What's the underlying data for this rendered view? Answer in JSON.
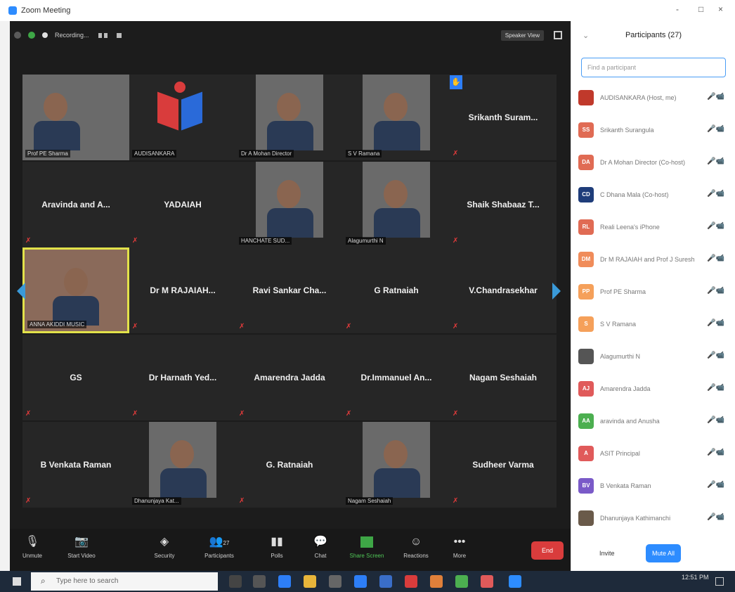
{
  "window": {
    "title": "Zoom Meeting",
    "minimize": "-",
    "restore": "□",
    "close": "×"
  },
  "meeting": {
    "recording_label": "Recording...",
    "speaker_view_label": "Speaker View"
  },
  "tiles": [
    {
      "text": "Prof PE Sharma",
      "kind": "video"
    },
    {
      "text": "AUDISANKARA",
      "kind": "logo"
    },
    {
      "text": "Dr A Mohan Director",
      "kind": "video"
    },
    {
      "text": "S V Ramana",
      "kind": "video"
    },
    {
      "text": "Srikanth Suram...",
      "kind": "name"
    },
    {
      "text": "Aravinda and A...",
      "kind": "name"
    },
    {
      "text": "YADAIAH",
      "kind": "name"
    },
    {
      "text": "HANCHATE SUD...",
      "kind": "video"
    },
    {
      "text": "Alagumurthi N",
      "kind": "video"
    },
    {
      "text": "Shaik Shabaaz T...",
      "kind": "name"
    },
    {
      "text": "ANNA AKIDDI MUSIC",
      "kind": "active"
    },
    {
      "text": "Dr M RAJAIAH...",
      "kind": "name"
    },
    {
      "text": "Ravi Sankar Cha...",
      "kind": "name"
    },
    {
      "text": "G Ratnaiah",
      "kind": "name"
    },
    {
      "text": "V.Chandrasekhar",
      "kind": "name"
    },
    {
      "text": "GS",
      "kind": "name"
    },
    {
      "text": "Dr Harnath Yed...",
      "kind": "name"
    },
    {
      "text": "Amarendra Jadda",
      "kind": "name"
    },
    {
      "text": "Dr.Immanuel An...",
      "kind": "name"
    },
    {
      "text": "Nagam Seshaiah",
      "kind": "name"
    },
    {
      "text": "B Venkata Raman",
      "kind": "name"
    },
    {
      "text": "Dhanunjaya Kat...",
      "kind": "video"
    },
    {
      "text": "G. Ratnaiah",
      "kind": "name"
    },
    {
      "text": "Nagam Seshaiah",
      "kind": "video"
    },
    {
      "text": "Sudheer Varma",
      "kind": "name"
    }
  ],
  "toolbar": {
    "unmute": "Unmute",
    "start_video": "Start Video",
    "security": "Security",
    "participants": "Participants",
    "participants_count": "27",
    "polls": "Polls",
    "chat": "Chat",
    "share_screen": "Share Screen",
    "reactions": "Reactions",
    "more": "More",
    "end": "End"
  },
  "panel": {
    "title": "Participants (27)",
    "search_placeholder": "Find a participant",
    "items": [
      {
        "initials": "",
        "name": "AUDISANKARA (Host, me)",
        "color": "#c0392b"
      },
      {
        "initials": "SS",
        "name": "Srikanth Surangula",
        "color": "#e06b54"
      },
      {
        "initials": "DA",
        "name": "Dr A Mohan Director (Co-host)",
        "color": "#e06b54"
      },
      {
        "initials": "CD",
        "name": "C Dhana Mala (Co-host)",
        "color": "#1f3d7a"
      },
      {
        "initials": "RL",
        "name": "Reali Leena's iPhone",
        "color": "#e06b54"
      },
      {
        "initials": "DM",
        "name": "Dr M RAJAIAH and Prof J Suresh",
        "color": "#f08c5a"
      },
      {
        "initials": "PP",
        "name": "Prof PE Sharma",
        "color": "#f5a05a"
      },
      {
        "initials": "S",
        "name": "S V Ramana",
        "color": "#f5a05a"
      },
      {
        "initials": "",
        "name": "Alagumurthi N",
        "color": "#555555"
      },
      {
        "initials": "AJ",
        "name": "Amarendra Jadda",
        "color": "#e05a5a"
      },
      {
        "initials": "AA",
        "name": "aravinda and Anusha",
        "color": "#4caf50"
      },
      {
        "initials": "A",
        "name": "ASIT Principal",
        "color": "#e05a5a"
      },
      {
        "initials": "BV",
        "name": "B Venkata Raman",
        "color": "#7a5ac8"
      },
      {
        "initials": "",
        "name": "Dhanunjaya Kathimanchi",
        "color": "#6a5a4a"
      }
    ],
    "invite": "Invite",
    "mute_all": "Mute All"
  },
  "taskbar": {
    "search_placeholder": "Type here to search",
    "time": "12:51 PM"
  }
}
